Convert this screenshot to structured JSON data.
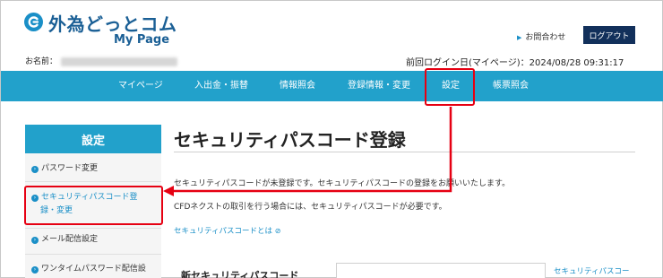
{
  "header": {
    "logo_text": "外為どっとコム",
    "logo_sub": "My Page",
    "contact_label": "お問合わせ",
    "logout_label": "ログアウト",
    "user_label": "お名前：",
    "last_login": "前回ログイン日(マイページ)：2024/08/28 09:31:17"
  },
  "nav": {
    "items": [
      "マイページ",
      "入出金・振替",
      "情報照会",
      "登録情報・変更",
      "設定",
      "帳票照会"
    ]
  },
  "sidebar": {
    "title": "設定",
    "items": [
      {
        "label": "パスワード変更"
      },
      {
        "label_line1": "セキュリティパスコード登",
        "label_line2": "録・変更"
      },
      {
        "label": "メール配信設定"
      },
      {
        "label": "ワンタイムパスワード配信設"
      }
    ]
  },
  "main": {
    "title": "セキュリティパスコード登録",
    "message1": "セキュリティパスコードが未登録です。セキュリティパスコードの登録をお願いいたします。",
    "message2": "CFDネクストの取引を行う場合には、セキュリティパスコードが必要です。",
    "about_link": "セキュリティパスコードとは",
    "form_label": "新セキュリティパスコード",
    "form_value": "",
    "form_link": "セキュリティパスコー"
  },
  "colors": {
    "brand_blue": "#22a1cb",
    "navy": "#12305b",
    "annotation_red": "#e60012"
  }
}
